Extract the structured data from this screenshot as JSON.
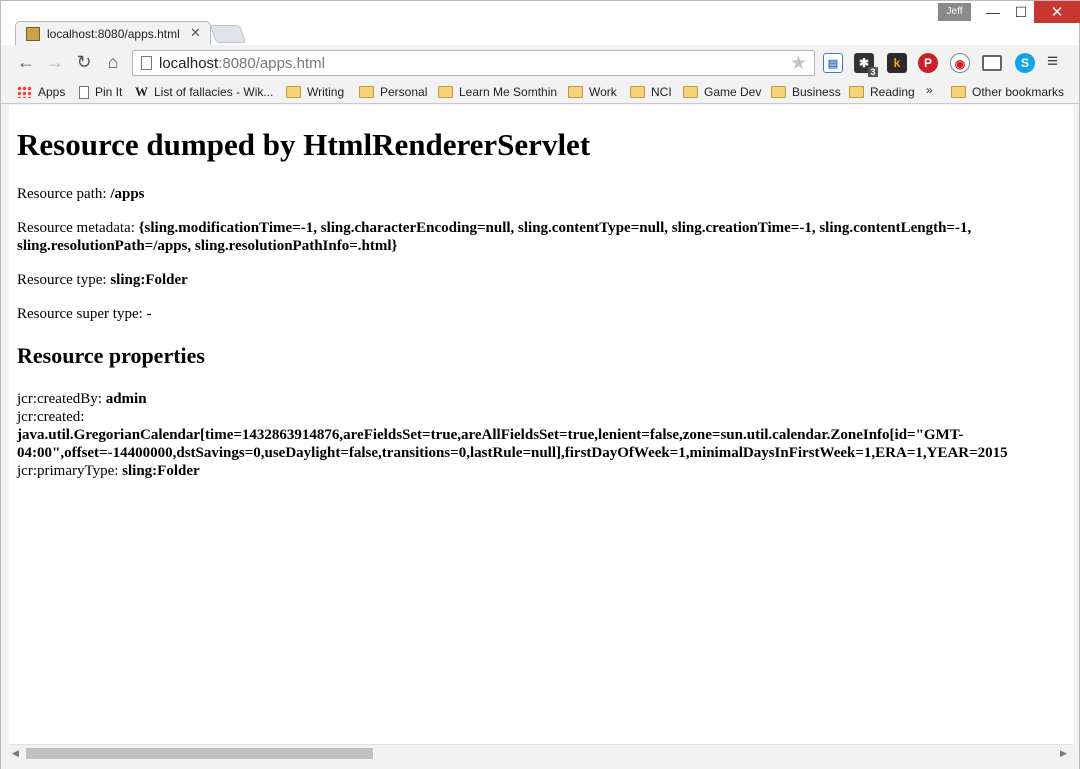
{
  "window": {
    "user_badge": "Jeff",
    "minimize": "—",
    "maximize": "☐",
    "close": "✕"
  },
  "tab": {
    "title": "localhost:8080/apps.html",
    "close": "✕"
  },
  "toolbar": {
    "back": "←",
    "forward": "→",
    "reload": "↻",
    "home": "⌂",
    "url_host": "localhost",
    "url_rest": ":8080/apps.html",
    "star": "★",
    "menu": "≡",
    "extensions": [
      {
        "name": "docs-icon",
        "glyph": "▤"
      },
      {
        "name": "puzzle-extension-icon",
        "glyph": "✱",
        "count": "3"
      },
      {
        "name": "k-extension-icon",
        "glyph": "k"
      },
      {
        "name": "pinterest-icon",
        "glyph": "P"
      },
      {
        "name": "pdf-extension-icon",
        "glyph": "◉"
      },
      {
        "name": "cast-icon",
        "glyph": "▭"
      },
      {
        "name": "skype-icon",
        "glyph": "S"
      }
    ]
  },
  "bookmarks": {
    "items": [
      {
        "label": "Apps",
        "icon": "apps-icon"
      },
      {
        "label": "Pin It",
        "icon": "page-icon"
      },
      {
        "label": "List of fallacies - Wik...",
        "icon": "wikipedia-icon"
      },
      {
        "label": "Writing",
        "icon": "folder-icon"
      },
      {
        "label": "Personal",
        "icon": "folder-icon"
      },
      {
        "label": "Learn Me Somthin",
        "icon": "folder-icon"
      },
      {
        "label": "Work",
        "icon": "folder-icon"
      },
      {
        "label": "NCI",
        "icon": "folder-icon"
      },
      {
        "label": "Game Dev",
        "icon": "folder-icon"
      },
      {
        "label": "Business",
        "icon": "folder-icon"
      },
      {
        "label": "Reading",
        "icon": "folder-icon"
      }
    ],
    "overflow": "»",
    "other": "Other bookmarks"
  },
  "page": {
    "title": "Resource dumped by HtmlRendererServlet",
    "path_label": "Resource path: ",
    "path_value": "/apps",
    "metadata_label": "Resource metadata: ",
    "metadata_line1": "{sling.modificationTime=-1, sling.characterEncoding=null, sling.contentType=null, sling.creationTime=-1, sling.contentLength=-1,",
    "metadata_line2": "sling.resolutionPath=/apps, sling.resolutionPathInfo=.html}",
    "type_label": "Resource type: ",
    "type_value": "sling:Folder",
    "super_type_label": "Resource super type: ",
    "super_type_value": "-",
    "properties_heading": "Resource properties",
    "created_by_label": "jcr:createdBy: ",
    "created_by_value": "admin",
    "created_label": "jcr:created:",
    "created_line1": "java.util.GregorianCalendar[time=1432863914876,areFieldsSet=true,areAllFieldsSet=true,lenient=false,zone=sun.util.calendar.ZoneInfo[id=\"GMT-",
    "created_line2": "04:00\",offset=-14400000,dstSavings=0,useDaylight=false,transitions=0,lastRule=null],firstDayOfWeek=1,minimalDaysInFirstWeek=1,ERA=1,YEAR=2015",
    "primary_type_label": "jcr:primaryType: ",
    "primary_type_value": "sling:Folder"
  },
  "scrollbar": {
    "left_arrow": "◀",
    "right_arrow": "▶"
  }
}
